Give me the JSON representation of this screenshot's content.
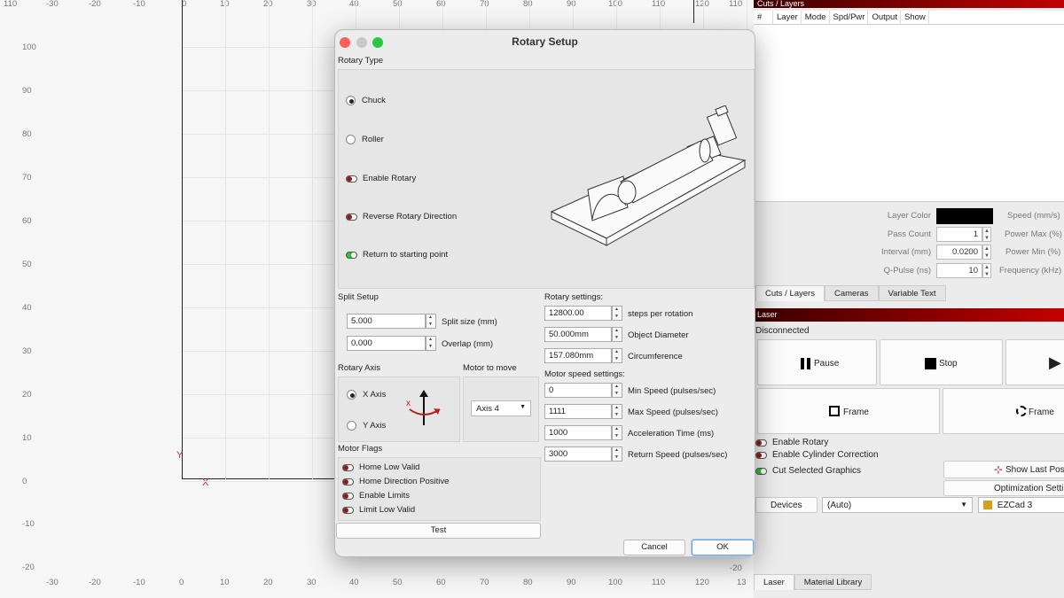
{
  "canvas": {
    "top_ticks": [
      "110",
      "-30",
      "-20",
      "-10",
      "0",
      "10",
      "20",
      "30",
      "40",
      "50",
      "60",
      "70",
      "80",
      "90",
      "100",
      "110",
      "120",
      "110"
    ],
    "bottom_ticks": [
      "-30",
      "-20",
      "-10",
      "0",
      "10",
      "20",
      "30",
      "40",
      "50",
      "60",
      "70",
      "80",
      "90",
      "100",
      "110",
      "120",
      "13"
    ],
    "left_ticks": [
      "100",
      "90",
      "80",
      "70",
      "60",
      "50",
      "40",
      "30",
      "20",
      "10",
      "0",
      "-10",
      "-20"
    ],
    "bottom_extra": "-20",
    "axis_y": "Y",
    "axis_x": "X"
  },
  "right": {
    "cuts_title": "Cuts / Layers",
    "columns": [
      "#",
      "Layer",
      "Mode",
      "Spd/Pwr",
      "Output",
      "Show"
    ],
    "props": {
      "layer_color_label": "Layer Color",
      "pass_count_label": "Pass Count",
      "pass_count": "1",
      "interval_label": "Interval (mm)",
      "interval": "0.0200",
      "qpulse_label": "Q-Pulse (ns)",
      "qpulse": "10",
      "speed_label": "Speed (mm/s)",
      "power_max_label": "Power Max (%)",
      "power_min_label": "Power Min (%)",
      "frequency_label": "Frequency (kHz)"
    },
    "tabs": [
      "Cuts / Layers",
      "Cameras",
      "Variable Text"
    ],
    "laser_title": "Laser",
    "status": "Disconnected",
    "buttons": {
      "pause": "Pause",
      "stop": "Stop",
      "frame1": "Frame",
      "frame2": "Frame",
      "show_last": "Show Last Posi",
      "optimization": "Optimization Setti"
    },
    "flags": {
      "enable_rotary": "Enable Rotary",
      "enable_cylinder": "Enable Cylinder Correction",
      "cut_selected": "Cut Selected Graphics"
    },
    "devices_label": "Devices",
    "device_select": "(Auto)",
    "device_name": "EZCad 3",
    "bottom_tabs": [
      "Laser",
      "Material Library"
    ],
    "accent": "#c40000"
  },
  "dialog": {
    "title": "Rotary Setup",
    "rotary_type_label": "Rotary Type",
    "chuck": "Chuck",
    "roller": "Roller",
    "enable_rotary": "Enable Rotary",
    "reverse_rotary": "Reverse Rotary Direction",
    "return_start": "Return to starting point",
    "split_setup_label": "Split Setup",
    "split_size": "5.000",
    "split_size_label": "Split size (mm)",
    "overlap": "0.000",
    "overlap_label": "Overlap (mm)",
    "rotary_axis_label": "Rotary Axis",
    "motor_to_move_label": "Motor to move",
    "x_axis": "X Axis",
    "y_axis": "Y Axis",
    "motor_select": "Axis 4",
    "motor_flags_label": "Motor Flags",
    "home_low_valid": "Home Low Valid",
    "home_direction_positive": "Home Direction Positive",
    "enable_limits": "Enable Limits",
    "limit_low_valid": "Limit Low Valid",
    "test_button": "Test",
    "rotary_settings_label": "Rotary settings:",
    "steps": "12800.00",
    "steps_label": "steps per rotation",
    "diameter": "50.000mm",
    "diameter_label": "Object Diameter",
    "circumference": "157.080mm",
    "circumference_label": "Circumference",
    "motor_speed_label": "Motor speed settings:",
    "min_speed": "0",
    "min_speed_label": "Min Speed (pulses/sec)",
    "max_speed": "1111",
    "max_speed_label": "Max Speed (pulses/sec)",
    "accel": "1000",
    "accel_label": "Acceleration Time (ms)",
    "return_speed": "3000",
    "return_speed_label": "Return Speed (pulses/sec)",
    "cancel": "Cancel",
    "ok": "OK"
  }
}
